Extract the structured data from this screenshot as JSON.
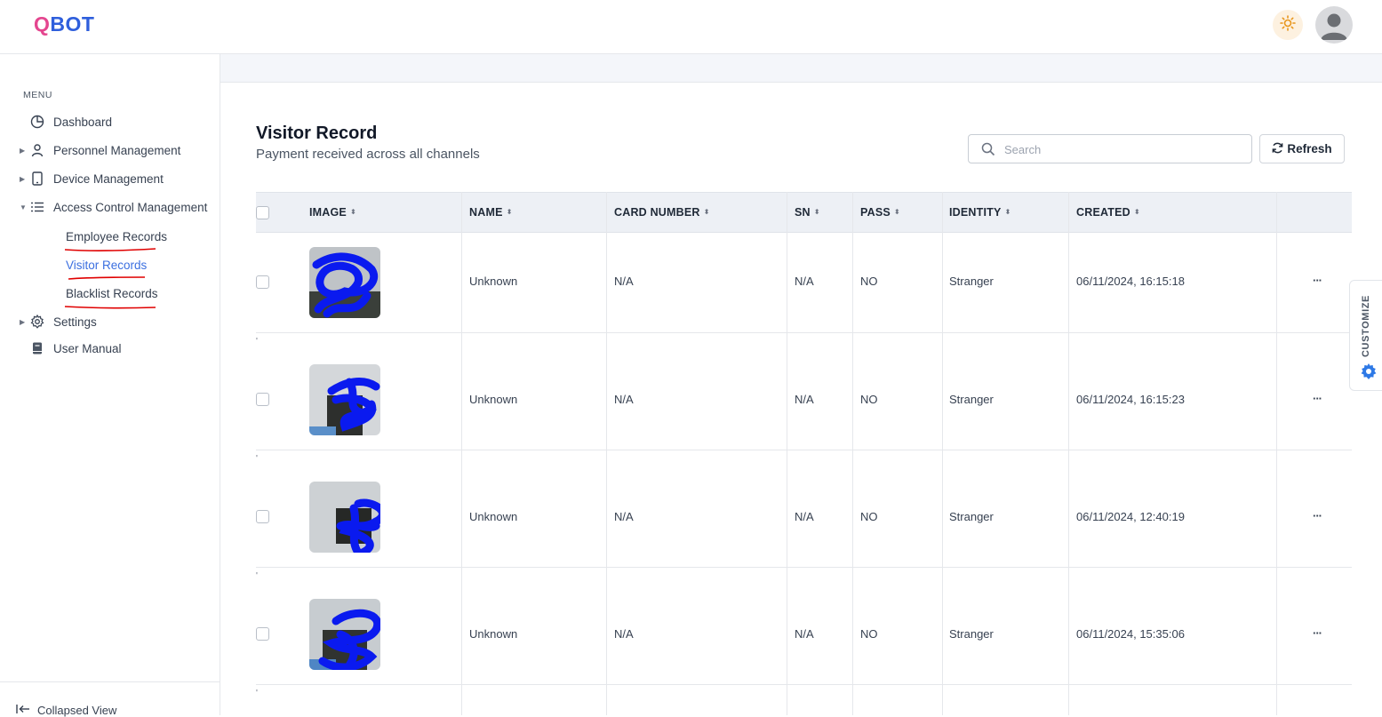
{
  "header": {
    "logo_q": "Q",
    "logo_rest": "BOT",
    "theme_icon": "sun-icon",
    "avatar_icon": "user-avatar-icon"
  },
  "sidebar": {
    "menu_label": "MENU",
    "items": [
      {
        "label": "Dashboard",
        "icon": "pie-chart-icon"
      },
      {
        "label": "Personnel Management",
        "icon": "person-icon"
      },
      {
        "label": "Device Management",
        "icon": "tablet-icon"
      },
      {
        "label": "Access Control Management",
        "icon": "list-icon"
      },
      {
        "label": "Settings",
        "icon": "gear-icon"
      },
      {
        "label": "User Manual",
        "icon": "book-icon"
      }
    ],
    "sub_items": [
      {
        "label": "Employee Records"
      },
      {
        "label": "Visitor Records",
        "active": true
      },
      {
        "label": "Blacklist Records"
      }
    ],
    "collapse_label": "Collapsed View"
  },
  "page": {
    "title": "Visitor Record",
    "subtitle": "Payment received across all channels"
  },
  "search": {
    "placeholder": "Search"
  },
  "refresh_label": "Refresh",
  "table": {
    "headers": [
      "IMAGE",
      "NAME",
      "CARD NUMBER",
      "SN",
      "PASS",
      "IDENTITY",
      "CREATED"
    ],
    "rows": [
      {
        "name": "Unknown",
        "card_number": "N/A",
        "sn": "N/A",
        "pass": "NO",
        "identity": "Stranger",
        "created": "06/11/2024, 16:15:18"
      },
      {
        "name": "Unknown",
        "card_number": "N/A",
        "sn": "N/A",
        "pass": "NO",
        "identity": "Stranger",
        "created": "06/11/2024, 16:15:23"
      },
      {
        "name": "Unknown",
        "card_number": "N/A",
        "sn": "N/A",
        "pass": "NO",
        "identity": "Stranger",
        "created": "06/11/2024, 12:40:19"
      },
      {
        "name": "Unknown",
        "card_number": "N/A",
        "sn": "N/A",
        "pass": "NO",
        "identity": "Stranger",
        "created": "06/11/2024, 15:35:06"
      }
    ],
    "row_action": "···"
  },
  "customize_label": "CUSTOMIZE",
  "colors": {
    "accent": "#3b6fe0",
    "logo_pink": "#e4468f",
    "logo_blue": "#2f5fdc",
    "annotation_red": "#e00000",
    "scribble_blue": "#0a1aef"
  }
}
